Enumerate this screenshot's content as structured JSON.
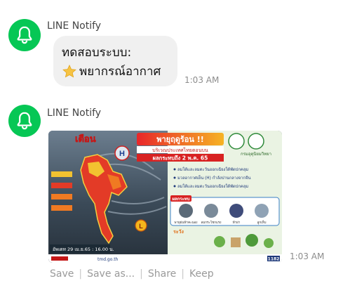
{
  "messages": [
    {
      "sender": "LINE Notify",
      "text_line1": "ทดสอบระบบ:",
      "text_line2": "พยากรณ์อากาศ",
      "time": "1:03 AM"
    },
    {
      "sender": "LINE Notify",
      "time": "1:03 AM",
      "poster": {
        "title": "พายุฤดูร้อน !!",
        "subtitle": "บริเวณประเทศไทยตอนบน",
        "date_banner": "ผลกระทบถึง 2 พ.ค. 65",
        "left_title": "เตือน",
        "h_label": "H",
        "l_label": "L",
        "bullets": [
          "ลมใต้และลมตะวันออกเฉียงใต้พัดปกคลุม",
          "มวลอากาศเย็น (H) กำลังปานกลางจากจีน",
          "ลมใต้และลมตะวันออกเฉียงใต้พัดปกคลุม"
        ],
        "effects_label": "ผลกระทบ",
        "effect_items": [
          "พายุฝนฟ้าคะนอง",
          "ลมกระโชกแรง",
          "ฟ้าผ่า",
          "ลูกเห็บ"
        ],
        "caution_label": "ระวัง",
        "issued": "อัพเดท 29 เม.ย.65 : 16.00 น.",
        "footer_left": "tmd.go.th",
        "footer_right": "1182",
        "agency": "กรมอุตุนิยมวิทยา"
      }
    }
  ],
  "actions": [
    "Save",
    "Save as...",
    "Share",
    "Keep"
  ],
  "colors": {
    "avatar": "#06c755",
    "bubble": "#f0f0f0",
    "time": "#8c8c8c"
  }
}
